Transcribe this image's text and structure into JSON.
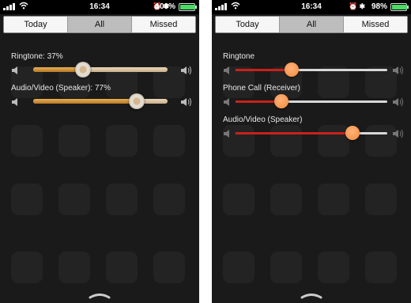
{
  "left": {
    "status": {
      "time": "16:34",
      "battery_pct": "100%",
      "battery_level": 1.0
    },
    "tabs": [
      {
        "label": "Today",
        "selected": false
      },
      {
        "label": "All",
        "selected": true
      },
      {
        "label": "Missed",
        "selected": false
      }
    ],
    "sliders": [
      {
        "label": "Ringtone: 37%",
        "value": 0.37
      },
      {
        "label": "Audio/Video (Speaker): 77%",
        "value": 0.77
      }
    ]
  },
  "right": {
    "status": {
      "time": "16:34",
      "battery_pct": "98%",
      "battery_level": 0.98
    },
    "tabs": [
      {
        "label": "Today",
        "selected": false
      },
      {
        "label": "All",
        "selected": true
      },
      {
        "label": "Missed",
        "selected": false
      }
    ],
    "sliders": [
      {
        "label": "Ringtone",
        "value": 0.37
      },
      {
        "label": "Phone Call (Receiver)",
        "value": 0.3
      },
      {
        "label": "Audio/Video (Speaker)",
        "value": 0.77
      }
    ]
  },
  "colors": {
    "left_fill": "#d69a45",
    "right_fill": "#c8211a",
    "right_knob": "#f08a3a",
    "battery": "#4cd964"
  },
  "icons": {
    "signal": "signal-bars-icon",
    "wifi": "wifi-icon",
    "volume_low": "speaker-low-icon",
    "volume_high": "speaker-high-icon",
    "pull_handle": "chevron-handle-icon"
  }
}
